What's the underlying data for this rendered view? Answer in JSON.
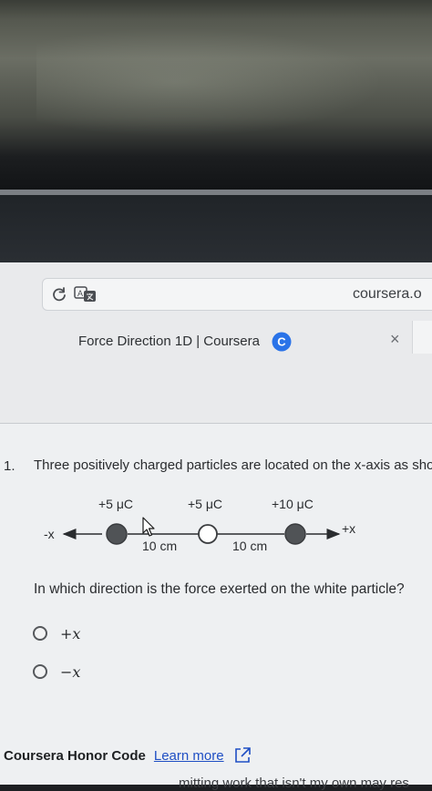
{
  "browser": {
    "url": "coursera.o",
    "tab_title": "Force Direction 1D | Coursera",
    "favicon_letter": "C",
    "close_symbol": "×",
    "icons": [
      "reload-icon",
      "translate-icon",
      "coursera-favicon-icon",
      "close-icon"
    ]
  },
  "question": {
    "number": "1.",
    "text": "Three positively charged particles are located on the x-axis as sho",
    "prompt": "In which direction is the force exerted on the white particle?",
    "options": [
      {
        "label": "+x"
      },
      {
        "label": "−x"
      }
    ]
  },
  "diagram": {
    "axis_neg": "-x",
    "axis_pos": "+x",
    "particles": [
      {
        "charge": "+5 μC",
        "fill": "#505356"
      },
      {
        "charge": "+5 μC",
        "fill": "#ffffff"
      },
      {
        "charge": "+10 μC",
        "fill": "#505356"
      }
    ],
    "distances": [
      "10 cm",
      "10 cm"
    ]
  },
  "footer": {
    "honor_title": "Coursera Honor Code",
    "learn_more": "Learn more",
    "cutoff_text": "mitting work that isn't my own may res"
  }
}
